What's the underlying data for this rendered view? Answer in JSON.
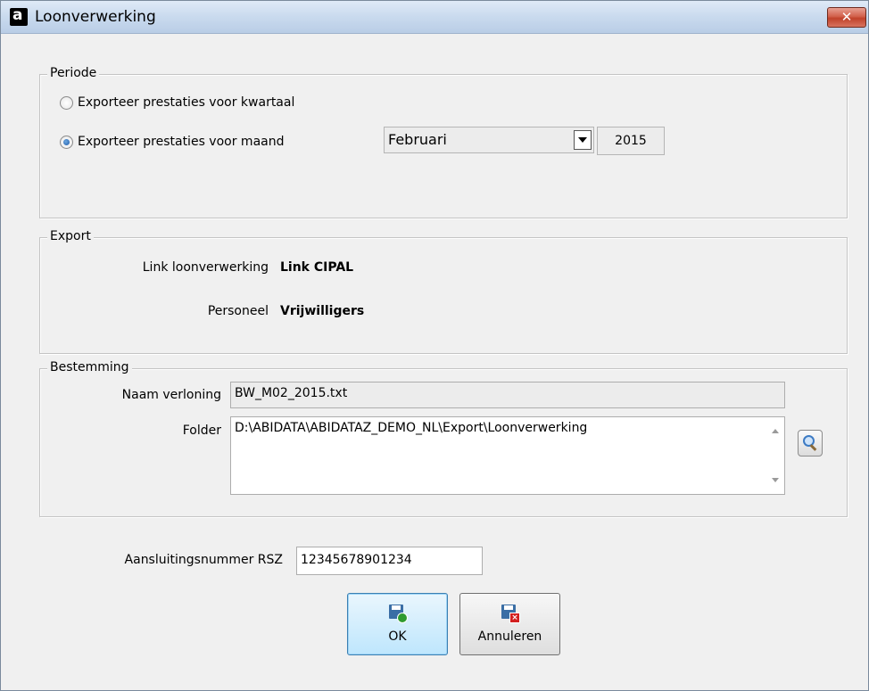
{
  "window": {
    "title": "Loonverwerking",
    "close_symbol": "✕"
  },
  "periode": {
    "legend": "Periode",
    "option_kwartaal": "Exporteer prestaties voor kwartaal",
    "option_maand": "Exporteer prestaties voor maand",
    "selected_option": "maand",
    "month": "Februari",
    "year": "2015"
  },
  "export": {
    "legend": "Export",
    "link_label": "Link loonverwerking",
    "link_value": "Link CIPAL",
    "personeel_label": "Personeel",
    "personeel_value": "Vrijwilligers"
  },
  "bestemming": {
    "legend": "Bestemming",
    "naam_label": "Naam verloning",
    "naam_value": "BW_M02_2015.txt",
    "folder_label": "Folder",
    "folder_value": "D:\\ABIDATA\\ABIDATAZ_DEMO_NL\\Export\\Loonverwerking"
  },
  "rsz": {
    "label": "Aansluitingsnummer RSZ",
    "value": "12345678901234"
  },
  "buttons": {
    "ok_label": "OK",
    "cancel_label": "Annuleren"
  },
  "colors": {
    "ok_accent": "#bee6fd",
    "close_red": "#c0412a"
  }
}
